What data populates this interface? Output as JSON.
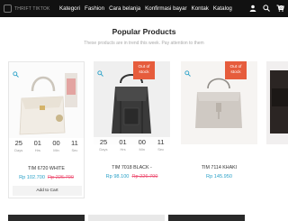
{
  "brand": {
    "logo_text": "THRIFT TIKTOK"
  },
  "nav": {
    "items": [
      "Kategori",
      "Fashion",
      "Cara belanja",
      "Konfirmasi bayar",
      "Kontak",
      "Katalog"
    ],
    "cart_count": "0"
  },
  "section": {
    "title": "Popular Products",
    "subtitle": "These products are in trend this week. Pay attention to them"
  },
  "countdown_units": [
    "Days",
    "Hrs",
    "Min",
    "Sec"
  ],
  "products": [
    {
      "name": "TIM 6720 WHITE",
      "price": "Rp 102.700",
      "old_price": "Rp 226.700",
      "countdown": [
        "25",
        "01",
        "00",
        "11"
      ],
      "badge": "",
      "button": "Add to Cart"
    },
    {
      "name": "TIM 7018 BLACK -",
      "price": "Rp 98.100",
      "old_price": "Rp 226.700",
      "countdown": [
        "25",
        "01",
        "00",
        "11"
      ],
      "badge": "Out of stock",
      "button": ""
    },
    {
      "name": "TIM 7114 KHAKI",
      "price": "Rp 145.950",
      "old_price": "",
      "countdown": [],
      "badge": "Out of stock",
      "button": ""
    }
  ],
  "colors": {
    "navbar": "#111111",
    "price": "#2aa1c8",
    "badge": "#e65c3c",
    "old_price": "#ee5577"
  }
}
